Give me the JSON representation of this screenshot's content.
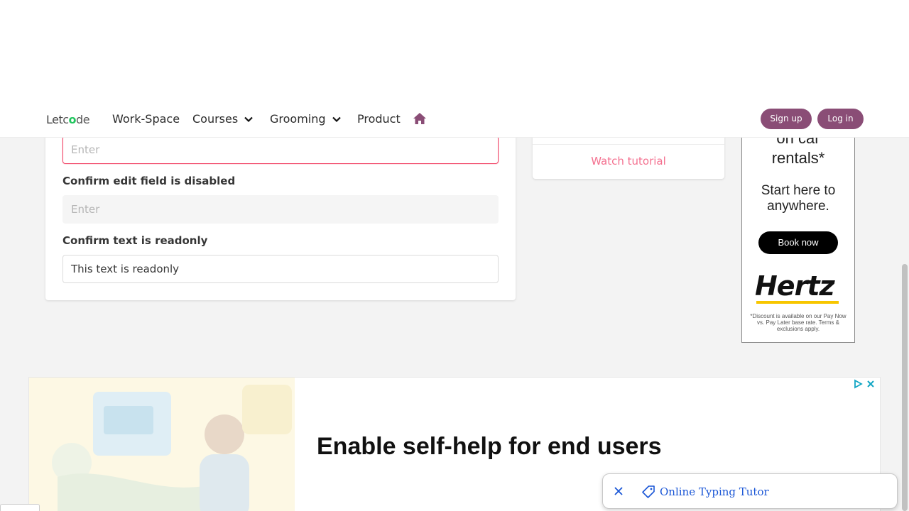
{
  "nav": {
    "logo_left": "Let",
    "logo_mid": "c",
    "logo_o": "o",
    "logo_right": "de",
    "items": [
      {
        "label": "Work-Space"
      },
      {
        "label": "Courses"
      },
      {
        "label": "Grooming"
      },
      {
        "label": "Product"
      }
    ],
    "signup_label": "Sign up",
    "login_label": "Log in",
    "accent_color": "#8a4d76"
  },
  "form": {
    "field1": {
      "placeholder": "Enter",
      "value": ""
    },
    "field2": {
      "label": "Confirm edit field is disabled",
      "placeholder": "Enter"
    },
    "field3": {
      "label": "Confirm text is readonly",
      "value": "This text is readonly"
    }
  },
  "tutorial": {
    "link_label": "Watch tutorial"
  },
  "hertz_ad": {
    "line1": "on car",
    "line2": "rentals*",
    "line3": "Start here to",
    "line4": "anywhere.",
    "button": "Book now",
    "brand": "Hertz",
    "fine_print": "*Discount is available on our Pay Now vs. Pay Later base rate. Terms & exclusions apply."
  },
  "bottom_ad": {
    "headline": "Enable self-help for end users"
  },
  "chip": {
    "text": "Online Typing Tutor"
  }
}
